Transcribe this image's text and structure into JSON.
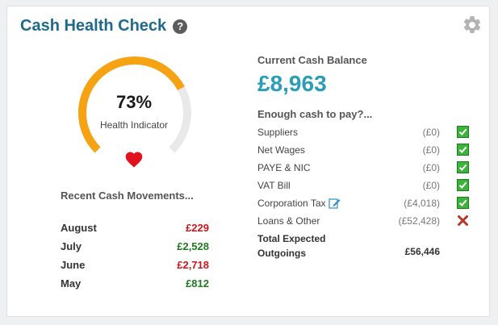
{
  "header": {
    "title": "Cash Health Check",
    "help_glyph": "?",
    "settings_icon": "gear-icon"
  },
  "gauge": {
    "percent_text": "73%",
    "percent_value": 73,
    "label": "Health Indicator",
    "colors": {
      "fill": "#f5a313",
      "track": "#e9e9e9",
      "heart": "#e1121d"
    }
  },
  "movements": {
    "heading": "Recent Cash Movements...",
    "rows": [
      {
        "month": "August",
        "amount": "£229",
        "direction": "negative"
      },
      {
        "month": "July",
        "amount": "£2,528",
        "direction": "positive"
      },
      {
        "month": "June",
        "amount": "£2,718",
        "direction": "negative"
      },
      {
        "month": "May",
        "amount": "£812",
        "direction": "positive"
      }
    ]
  },
  "balance": {
    "heading": "Current Cash Balance",
    "value": "£8,963"
  },
  "pay": {
    "heading": "Enough cash to pay?...",
    "rows": [
      {
        "label": "Suppliers",
        "amount": "(£0)",
        "status": "ok"
      },
      {
        "label": "Net Wages",
        "amount": "(£0)",
        "status": "ok"
      },
      {
        "label": "PAYE & NIC",
        "amount": "(£0)",
        "status": "ok"
      },
      {
        "label": "VAT Bill",
        "amount": "(£0)",
        "status": "ok"
      },
      {
        "label": "Corporation Tax",
        "amount": "(£4,018)",
        "status": "ok",
        "editable": true
      },
      {
        "label": "Loans & Other",
        "amount": "(£52,428)",
        "status": "fail"
      }
    ],
    "total_label": "Total Expected Outgoings",
    "total_amount": "£56,446"
  }
}
